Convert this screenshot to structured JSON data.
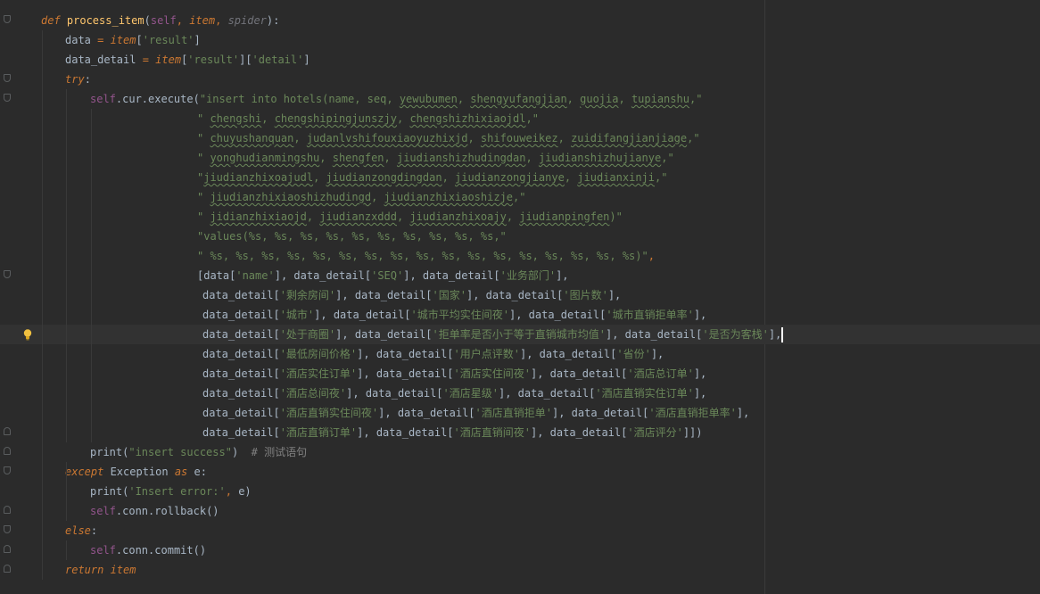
{
  "editor": {
    "colors": {
      "background": "#2b2b2b",
      "keyword": "#cc7832",
      "function": "#ffc66d",
      "string": "#6a8759",
      "comment": "#808080",
      "self": "#94558d",
      "text": "#a9b7c6"
    },
    "gutter_icons": [
      "fold-marker-icon",
      "lightbulb-icon"
    ],
    "lines": [
      {
        "indent": 0,
        "fold": "top",
        "segments": [
          {
            "t": "def ",
            "c": "kwi"
          },
          {
            "t": "process_item",
            "c": "fn"
          },
          {
            "t": "(",
            "c": ""
          },
          {
            "t": "self",
            "c": "self"
          },
          {
            "t": ", ",
            "c": "kw"
          },
          {
            "t": "item",
            "c": "itemv"
          },
          {
            "t": ", ",
            "c": "kw"
          },
          {
            "t": "spider",
            "c": "paramu"
          },
          {
            "t": "):",
            "c": ""
          }
        ]
      },
      {
        "indent": 1,
        "segments": [
          {
            "t": "data ",
            "c": ""
          },
          {
            "t": "= ",
            "c": "kw"
          },
          {
            "t": "item",
            "c": "itemv"
          },
          {
            "t": "[",
            "c": ""
          },
          {
            "t": "'result'",
            "c": "str"
          },
          {
            "t": "]",
            "c": ""
          }
        ]
      },
      {
        "indent": 1,
        "segments": [
          {
            "t": "data_detail ",
            "c": ""
          },
          {
            "t": "= ",
            "c": "kw"
          },
          {
            "t": "item",
            "c": "itemv"
          },
          {
            "t": "[",
            "c": ""
          },
          {
            "t": "'result'",
            "c": "str"
          },
          {
            "t": "][",
            "c": ""
          },
          {
            "t": "'detail'",
            "c": "str"
          },
          {
            "t": "]",
            "c": ""
          }
        ]
      },
      {
        "indent": 1,
        "fold": "top",
        "segments": [
          {
            "t": "try",
            "c": "kwi"
          },
          {
            "t": ":",
            "c": ""
          }
        ]
      },
      {
        "indent": 2,
        "fold": "top",
        "segments": [
          {
            "t": "self",
            "c": "self"
          },
          {
            "t": ".cur.",
            "c": ""
          },
          {
            "t": "execute",
            "c": "meth"
          },
          {
            "t": "(",
            "c": ""
          },
          {
            "t": "\"insert into hotels(name, seq, ",
            "c": "str"
          },
          {
            "t": "yewubumen",
            "c": "str wavy"
          },
          {
            "t": ", ",
            "c": "str"
          },
          {
            "t": "shengyufangjian",
            "c": "str wavy"
          },
          {
            "t": ", ",
            "c": "str"
          },
          {
            "t": "guojia",
            "c": "str wavy"
          },
          {
            "t": ", ",
            "c": "str"
          },
          {
            "t": "tupianshu",
            "c": "str wavy"
          },
          {
            "t": ",\"",
            "c": "str"
          }
        ]
      },
      {
        "indent": "cont",
        "segments": [
          {
            "t": "\" ",
            "c": "str"
          },
          {
            "t": "chengshi",
            "c": "str wavy"
          },
          {
            "t": ", ",
            "c": "str"
          },
          {
            "t": "chengshipingjunszjy",
            "c": "str wavy"
          },
          {
            "t": ", ",
            "c": "str"
          },
          {
            "t": "chengshizhixiaojdl",
            "c": "str wavy"
          },
          {
            "t": ",\"",
            "c": "str"
          }
        ]
      },
      {
        "indent": "cont",
        "segments": [
          {
            "t": "\" ",
            "c": "str"
          },
          {
            "t": "chuyushanquan",
            "c": "str wavy"
          },
          {
            "t": ", ",
            "c": "str"
          },
          {
            "t": "judanlvshifouxiaoyuzhixjd",
            "c": "str wavy"
          },
          {
            "t": ", ",
            "c": "str"
          },
          {
            "t": "shifouweikez",
            "c": "str wavy"
          },
          {
            "t": ", ",
            "c": "str"
          },
          {
            "t": "zuidifangjianjiage",
            "c": "str wavy"
          },
          {
            "t": ",\"",
            "c": "str"
          }
        ]
      },
      {
        "indent": "cont",
        "segments": [
          {
            "t": "\" ",
            "c": "str"
          },
          {
            "t": "yonghudianmingshu",
            "c": "str wavy"
          },
          {
            "t": ", ",
            "c": "str"
          },
          {
            "t": "shengfen",
            "c": "str wavy"
          },
          {
            "t": ", ",
            "c": "str"
          },
          {
            "t": "jiudianshizhudingdan",
            "c": "str wavy"
          },
          {
            "t": ", ",
            "c": "str"
          },
          {
            "t": "jiudianshizhujianye",
            "c": "str wavy"
          },
          {
            "t": ",\"",
            "c": "str"
          }
        ]
      },
      {
        "indent": "cont",
        "segments": [
          {
            "t": "\"",
            "c": "str"
          },
          {
            "t": "jiudianzhixoajudl",
            "c": "str wavy"
          },
          {
            "t": ", ",
            "c": "str"
          },
          {
            "t": "jiudianzongdingdan",
            "c": "str wavy"
          },
          {
            "t": ", ",
            "c": "str"
          },
          {
            "t": "jiudianzongjianye",
            "c": "str wavy"
          },
          {
            "t": ", ",
            "c": "str"
          },
          {
            "t": "jiudianxinji",
            "c": "str wavy"
          },
          {
            "t": ",\"",
            "c": "str"
          }
        ]
      },
      {
        "indent": "cont",
        "segments": [
          {
            "t": "\" ",
            "c": "str"
          },
          {
            "t": "jiudianzhixiaoshizhudingd",
            "c": "str wavy"
          },
          {
            "t": ", ",
            "c": "str"
          },
          {
            "t": "jiudianzhixiaoshizje",
            "c": "str wavy"
          },
          {
            "t": ",\"",
            "c": "str"
          }
        ]
      },
      {
        "indent": "cont",
        "segments": [
          {
            "t": "\" ",
            "c": "str"
          },
          {
            "t": "jidianzhixiaojd",
            "c": "str wavy"
          },
          {
            "t": ", ",
            "c": "str"
          },
          {
            "t": "jiudianzxddd",
            "c": "str wavy"
          },
          {
            "t": ", ",
            "c": "str"
          },
          {
            "t": "jiudianzhixoajy",
            "c": "str wavy"
          },
          {
            "t": ", ",
            "c": "str"
          },
          {
            "t": "jiudianpingfen",
            "c": "str wavy"
          },
          {
            "t": ")\"",
            "c": "str"
          }
        ]
      },
      {
        "indent": "cont",
        "segments": [
          {
            "t": "\"values(%s, %s, %s, %s, %s, %s, %s, %s, %s, %s,\"",
            "c": "str"
          }
        ]
      },
      {
        "indent": "cont",
        "segments": [
          {
            "t": "\" %s, %s, %s, %s, %s, %s, %s, %s, %s, %s, %s, %s, %s, %s, %s, %s, %s)\"",
            "c": "str"
          },
          {
            "t": ",",
            "c": "kw"
          }
        ]
      },
      {
        "indent": "cont",
        "fold": "top",
        "segments": [
          {
            "t": "[data[",
            "c": ""
          },
          {
            "t": "'name'",
            "c": "str"
          },
          {
            "t": "], ",
            "c": ""
          },
          {
            "t": "data_detail[",
            "c": ""
          },
          {
            "t": "'SEQ'",
            "c": "str"
          },
          {
            "t": "], ",
            "c": ""
          },
          {
            "t": "data_detail[",
            "c": ""
          },
          {
            "t": "'业务部门'",
            "c": "str"
          },
          {
            "t": "],",
            "c": ""
          }
        ]
      },
      {
        "indent": "cont2",
        "segments": [
          {
            "t": "data_detail[",
            "c": ""
          },
          {
            "t": "'剩余房间'",
            "c": "str"
          },
          {
            "t": "], data_detail[",
            "c": ""
          },
          {
            "t": "'国家'",
            "c": "str"
          },
          {
            "t": "], data_detail[",
            "c": ""
          },
          {
            "t": "'图片数'",
            "c": "str"
          },
          {
            "t": "],",
            "c": ""
          }
        ]
      },
      {
        "indent": "cont2",
        "segments": [
          {
            "t": "data_detail[",
            "c": ""
          },
          {
            "t": "'城市'",
            "c": "str"
          },
          {
            "t": "], data_detail[",
            "c": ""
          },
          {
            "t": "'城市平均实住间夜'",
            "c": "str"
          },
          {
            "t": "], data_detail[",
            "c": ""
          },
          {
            "t": "'城市直销拒单率'",
            "c": "str"
          },
          {
            "t": "],",
            "c": ""
          }
        ]
      },
      {
        "indent": "cont2",
        "current": true,
        "bulb": true,
        "segments": [
          {
            "t": "data_detail[",
            "c": ""
          },
          {
            "t": "'处于商圈'",
            "c": "str"
          },
          {
            "t": "], data_detail[",
            "c": ""
          },
          {
            "t": "'拒单率是否小于等于直销城市均值'",
            "c": "str"
          },
          {
            "t": "], data_detail[",
            "c": ""
          },
          {
            "t": "'是否为客栈'",
            "c": "str"
          },
          {
            "t": "],",
            "c": ""
          }
        ]
      },
      {
        "indent": "cont2",
        "segments": [
          {
            "t": "data_detail[",
            "c": ""
          },
          {
            "t": "'最低房间价格'",
            "c": "str"
          },
          {
            "t": "], data_detail[",
            "c": ""
          },
          {
            "t": "'用户点评数'",
            "c": "str"
          },
          {
            "t": "], data_detail[",
            "c": ""
          },
          {
            "t": "'省份'",
            "c": "str"
          },
          {
            "t": "],",
            "c": ""
          }
        ]
      },
      {
        "indent": "cont2",
        "segments": [
          {
            "t": "data_detail[",
            "c": ""
          },
          {
            "t": "'酒店实住订单'",
            "c": "str"
          },
          {
            "t": "], data_detail[",
            "c": ""
          },
          {
            "t": "'酒店实住间夜'",
            "c": "str"
          },
          {
            "t": "], data_detail[",
            "c": ""
          },
          {
            "t": "'酒店总订单'",
            "c": "str"
          },
          {
            "t": "],",
            "c": ""
          }
        ]
      },
      {
        "indent": "cont2",
        "segments": [
          {
            "t": "data_detail[",
            "c": ""
          },
          {
            "t": "'酒店总间夜'",
            "c": "str"
          },
          {
            "t": "], data_detail[",
            "c": ""
          },
          {
            "t": "'酒店星级'",
            "c": "str"
          },
          {
            "t": "], data_detail[",
            "c": ""
          },
          {
            "t": "'酒店直销实住订单'",
            "c": "str"
          },
          {
            "t": "],",
            "c": ""
          }
        ]
      },
      {
        "indent": "cont2",
        "segments": [
          {
            "t": "data_detail[",
            "c": ""
          },
          {
            "t": "'酒店直销实住间夜'",
            "c": "str"
          },
          {
            "t": "], data_detail[",
            "c": ""
          },
          {
            "t": "'酒店直销拒单'",
            "c": "str"
          },
          {
            "t": "], data_detail[",
            "c": ""
          },
          {
            "t": "'酒店直销拒单率'",
            "c": "str"
          },
          {
            "t": "],",
            "c": ""
          }
        ]
      },
      {
        "indent": "cont2",
        "fold": "bottom",
        "segments": [
          {
            "t": "data_detail[",
            "c": ""
          },
          {
            "t": "'酒店直销订单'",
            "c": "str"
          },
          {
            "t": "], data_detail[",
            "c": ""
          },
          {
            "t": "'酒店直销间夜'",
            "c": "str"
          },
          {
            "t": "], data_detail[",
            "c": ""
          },
          {
            "t": "'酒店评分'",
            "c": "str"
          },
          {
            "t": "]])",
            "c": ""
          }
        ]
      },
      {
        "indent": 2,
        "fold": "bottom",
        "segments": [
          {
            "t": "print",
            "c": "meth"
          },
          {
            "t": "(",
            "c": ""
          },
          {
            "t": "\"insert success\"",
            "c": "str"
          },
          {
            "t": ")  ",
            "c": ""
          },
          {
            "t": "# 测试语句",
            "c": "cm"
          }
        ]
      },
      {
        "indent": 1,
        "fold": "top",
        "segments": [
          {
            "t": "except ",
            "c": "kwi"
          },
          {
            "t": "Exception ",
            "c": ""
          },
          {
            "t": "as ",
            "c": "kwi"
          },
          {
            "t": "e:",
            "c": ""
          }
        ]
      },
      {
        "indent": 2,
        "segments": [
          {
            "t": "print",
            "c": "meth"
          },
          {
            "t": "(",
            "c": ""
          },
          {
            "t": "'Insert error:'",
            "c": "str"
          },
          {
            "t": ", ",
            "c": "kw"
          },
          {
            "t": "e)",
            "c": ""
          }
        ]
      },
      {
        "indent": 2,
        "fold": "bottom",
        "segments": [
          {
            "t": "self",
            "c": "self"
          },
          {
            "t": ".conn.",
            "c": ""
          },
          {
            "t": "rollback",
            "c": "meth"
          },
          {
            "t": "()",
            "c": ""
          }
        ]
      },
      {
        "indent": 1,
        "fold": "top",
        "segments": [
          {
            "t": "else",
            "c": "kwi"
          },
          {
            "t": ":",
            "c": ""
          }
        ]
      },
      {
        "indent": 2,
        "fold": "bottom",
        "segments": [
          {
            "t": "self",
            "c": "self"
          },
          {
            "t": ".conn.",
            "c": ""
          },
          {
            "t": "commit",
            "c": "meth"
          },
          {
            "t": "()",
            "c": ""
          }
        ]
      },
      {
        "indent": 1,
        "fold": "bottom",
        "segments": [
          {
            "t": "return ",
            "c": "kwi"
          },
          {
            "t": "item",
            "c": "itemv"
          }
        ]
      }
    ]
  }
}
